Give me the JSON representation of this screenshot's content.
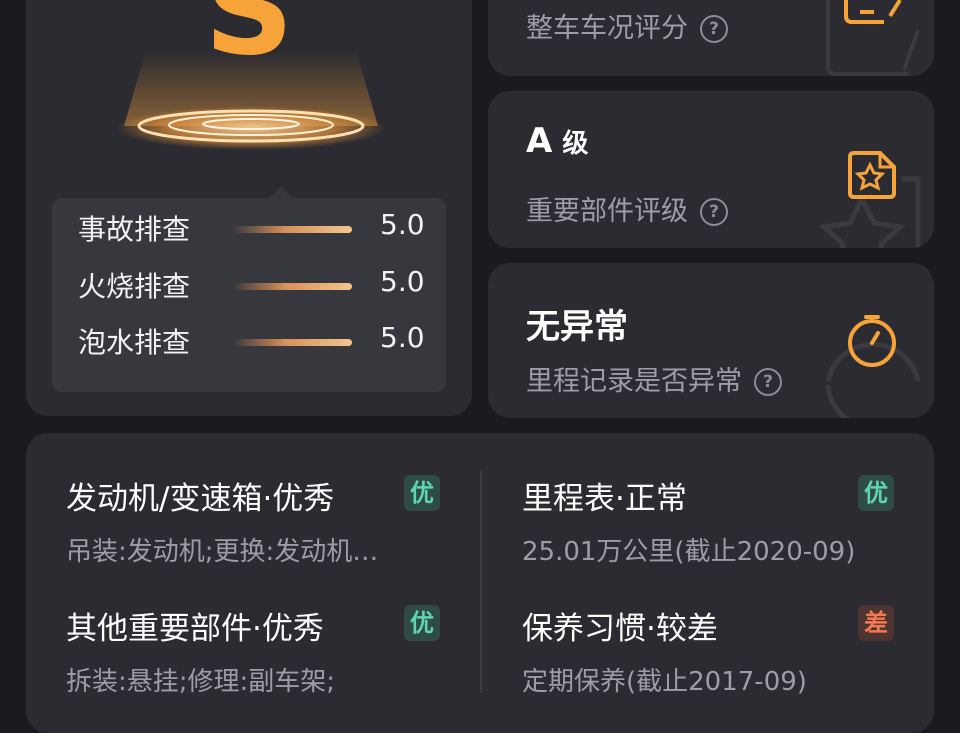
{
  "overall": {
    "grade": "S",
    "checks": [
      {
        "label": "事故排查",
        "score": "5.0"
      },
      {
        "label": "火烧排查",
        "score": "5.0"
      },
      {
        "label": "泡水排查",
        "score": "5.0"
      }
    ]
  },
  "summary_cards": [
    {
      "title": "",
      "title_suffix": "",
      "subtitle": "整车车况评分",
      "icon": "edit-document-icon"
    },
    {
      "title": "A",
      "title_suffix": "级",
      "subtitle": "重要部件评级",
      "icon": "star-document-icon"
    },
    {
      "title": "无异常",
      "title_suffix": "",
      "subtitle": "里程记录是否异常",
      "icon": "timer-icon"
    }
  ],
  "help_icon": "?",
  "details": [
    {
      "title": "发动机/变速箱·优秀",
      "badge": "优",
      "status": "good",
      "desc": "吊装:发动机;更换:发动机…"
    },
    {
      "title": "里程表·正常",
      "badge": "优",
      "status": "good",
      "desc": "25.01万公里(截止2020-09)"
    },
    {
      "title": "其他重要部件·优秀",
      "badge": "优",
      "status": "good",
      "desc": "拆装:悬挂;修理:副车架;"
    },
    {
      "title": "保养习惯·较差",
      "badge": "差",
      "status": "bad",
      "desc": "定期保养(截止2017-09)"
    }
  ],
  "colors": {
    "accent": "#f6a43a",
    "good_badge_bg": "#2f4b45",
    "good_badge_text": "#5fd3b4",
    "bad_badge_bg": "#4d3430",
    "bad_badge_text": "#f6794f"
  }
}
